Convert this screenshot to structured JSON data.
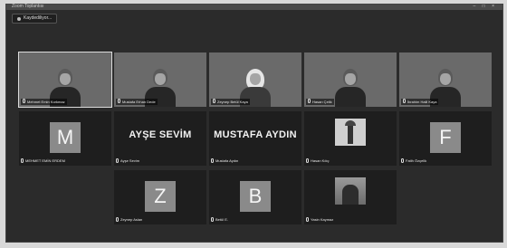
{
  "window": {
    "title": "Zoom Toplantısı",
    "controls": "– □ ×"
  },
  "recording_label": "Kaydediliyor...",
  "participants": [
    {
      "name": "Mehmet Emin Korkmaz",
      "kind": "video",
      "bg": "a",
      "active": true
    },
    {
      "name": "Mustafa Erhan Dede",
      "kind": "video",
      "bg": "b"
    },
    {
      "name": "Zeynep Betül Kaya",
      "kind": "video",
      "bg": "c",
      "hijab": true
    },
    {
      "name": "Hasan Çelik",
      "kind": "video",
      "bg": "d"
    },
    {
      "name": "İbrahim Halil Kaya",
      "kind": "video",
      "bg": "e"
    },
    {
      "name": "MEHMET EMİN ERDEM",
      "kind": "letter",
      "letter": "M"
    },
    {
      "name": "Ayşe Sevim",
      "kind": "bigname",
      "display": "AYŞE SEVİM"
    },
    {
      "name": "Mustafa Aydın",
      "kind": "bigname",
      "display": "MUSTAFA AYDIN"
    },
    {
      "name": "Hasan Kılıç",
      "kind": "thumb",
      "thumb": "tower"
    },
    {
      "name": "Fatih Özçelik",
      "kind": "letter",
      "letter": "F"
    },
    {
      "name": "Zeynep Aslan",
      "kind": "letter",
      "letter": "Z"
    },
    {
      "name": "Betül E.",
      "kind": "letter",
      "letter": "B"
    },
    {
      "name": "Yasin Kaymaz",
      "kind": "thumb",
      "thumb": "person"
    }
  ]
}
